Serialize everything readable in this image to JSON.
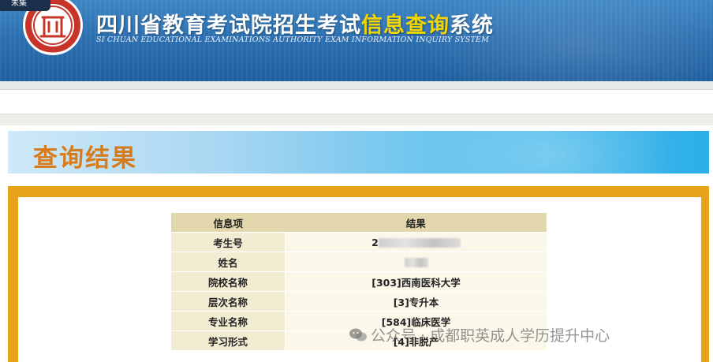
{
  "header": {
    "back_tab": "未集",
    "title_part1": "四川省教育考试院招生考试",
    "title_highlight": "信息查询",
    "title_part2": "系统",
    "title_en": "SI CHUAN EDUCATIONAL EXAMINATIONS AUTHORITY EXAM INFORMATION INQUIRY SYSTEM",
    "logo_icon": "sichuan-exam-authority-seal",
    "colors": {
      "header_blue": "#2c6fb0",
      "highlight_yellow": "#f3d600"
    }
  },
  "banner": {
    "title": "查询结果",
    "colors": {
      "title_orange": "#d77b1c",
      "frame_orange": "#e6a31b"
    }
  },
  "result_table": {
    "headers": [
      "信息项",
      "结果"
    ],
    "rows": [
      {
        "label": "考生号",
        "value": "2",
        "redacted": true
      },
      {
        "label": "姓名",
        "value": "",
        "redacted": true
      },
      {
        "label": "院校名称",
        "value": "[303]西南医科大学"
      },
      {
        "label": "层次名称",
        "value": "[3]专升本"
      },
      {
        "label": "专业名称",
        "value": "[584]临床医学"
      },
      {
        "label": "学习形式",
        "value": "[4]非脱产"
      }
    ]
  },
  "watermark": {
    "icon": "wechat-icon",
    "text": "公众号 · 成都职英成人学历提升中心"
  }
}
